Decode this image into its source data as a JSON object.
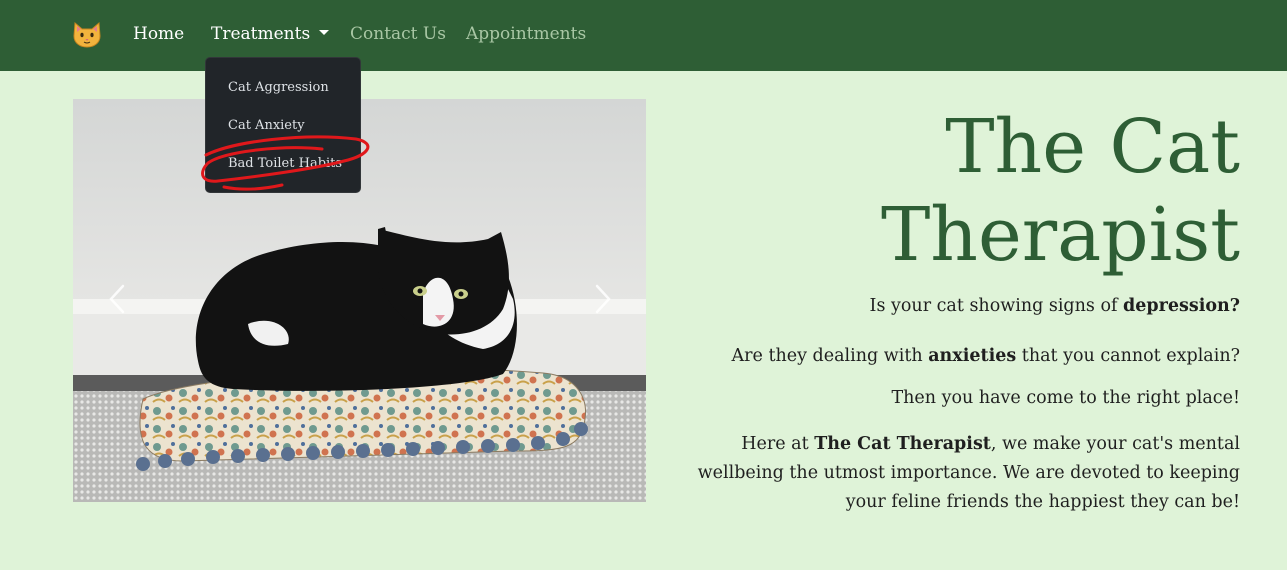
{
  "nav": {
    "brand_icon": "cat-face-icon",
    "home": "Home",
    "treatments": "Treatments",
    "contact": "Contact Us",
    "appointments": "Appointments"
  },
  "dropdown": {
    "items": [
      "Cat Aggression",
      "Cat Anxiety",
      "Bad Toilet Habits"
    ]
  },
  "carousel": {
    "prev_icon": "chevron-left-icon",
    "next_icon": "chevron-right-icon"
  },
  "hero": {
    "title_line1": "The Cat",
    "title_line2": "Therapist",
    "l1_pre": "Is your cat showing signs of ",
    "l1_bold": "depression?",
    "l2_pre": "Are they dealing with ",
    "l2_bold": "anxieties",
    "l2_post": " that you cannot explain?",
    "l3": "Then you have come to the right place!",
    "p_pre": "Here at ",
    "p_bold": "The Cat Therapist",
    "p_post": ", we make your cat's mental wellbeing the utmost importance. We are devoted to keeping your feline friends the happiest they can be!"
  },
  "colors": {
    "navbar": "#2e5e35",
    "page_bg": "#dff3d8",
    "title": "#2e5e35",
    "dropdown_bg": "#212529",
    "annotation": "#e0181b"
  }
}
